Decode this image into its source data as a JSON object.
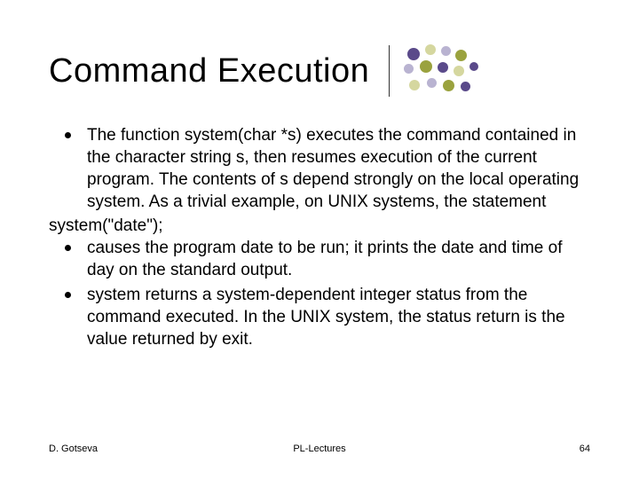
{
  "title": "Command Execution",
  "bullets": {
    "b1": "The function system(char *s) executes the command contained in the character string s, then resumes execution of the current program. The contents of s depend strongly on the local operating system. As a trivial example, on UNIX systems, the statement",
    "code": "system(\"date\");",
    "b2": "causes the program date to be run; it prints the date and time of day on the standard output.",
    "b3": "system returns a system-dependent integer status from the command executed. In the UNIX system, the status return is the value returned by exit."
  },
  "footer": {
    "left": "D. Gotseva",
    "center": "PL-Lectures",
    "right": "64"
  },
  "decor": {
    "dot_colors": {
      "purple": "#5a4a8a",
      "olive": "#9aa23e",
      "lightpurple": "#b9b3d1",
      "lightolive": "#d5d79f"
    }
  }
}
